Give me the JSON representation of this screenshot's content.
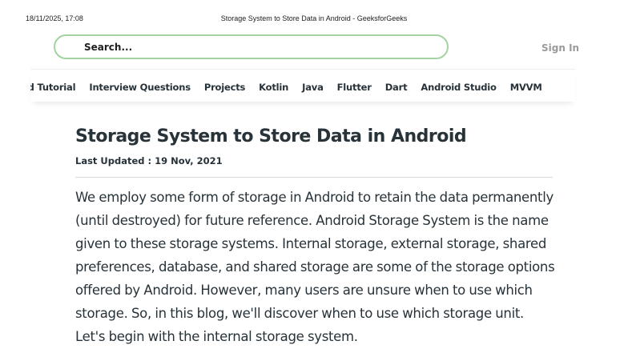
{
  "print_header": {
    "date": "18/11/2025, 17:08",
    "page_title": "Storage System to Store Data in Android - GeeksforGeeks"
  },
  "header": {
    "search_placeholder": "Search...",
    "sign_in_label": "Sign In"
  },
  "nav": {
    "items": [
      "Android Tutorial",
      "Interview Questions",
      "Projects",
      "Kotlin",
      "Java",
      "Flutter",
      "Dart",
      "Android Studio",
      "MVVM"
    ]
  },
  "article": {
    "title": "Storage System to Store Data in Android",
    "last_updated": "Last Updated : 19 Nov, 2021",
    "body": "We employ some form of storage in Android to retain the data permanently (until destroyed) for future reference. Android Storage System is the name given to these storage systems. Internal storage, external storage, shared preferences, database, and shared storage are some of the storage options offered by Android. However, many users are unsure when to use which storage. So, in this blog, we'll discover when to use which storage unit. Let's begin with the internal storage system."
  },
  "colors": {
    "search_border": "#a3d3a3",
    "text": "#273239",
    "sign_in": "#9a9a9a"
  }
}
